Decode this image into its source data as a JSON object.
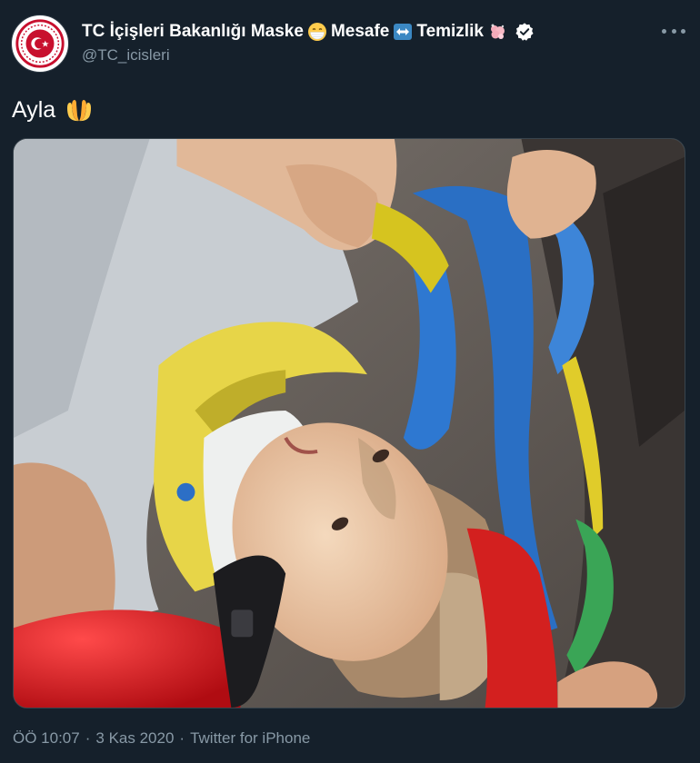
{
  "account": {
    "display_name_parts": [
      "TC İçişleri Bakanlığı Maske",
      "Mesafe",
      "Temizlik"
    ],
    "name_emojis": [
      "mask-face-emoji",
      "left-right-arrow-emoji",
      "hand-washing-emoji"
    ],
    "verified_badge": "verified-badge-icon",
    "handle": "@TC_icisleri"
  },
  "tweet": {
    "text": "Ayla",
    "text_emoji": "palms-up-together-emoji",
    "media": {
      "alt": "photo"
    }
  },
  "metadata": {
    "time": "ÖÖ 10:07",
    "separator": "·",
    "date": "3 Kas 2020",
    "source": "Twitter for iPhone"
  },
  "menu": {
    "icon": "more-horizontal-icon"
  },
  "colors": {
    "background": "#15202b",
    "secondary_text": "#8899a6",
    "verified": "#ffffff",
    "avatar_logo": "#c8102e"
  }
}
